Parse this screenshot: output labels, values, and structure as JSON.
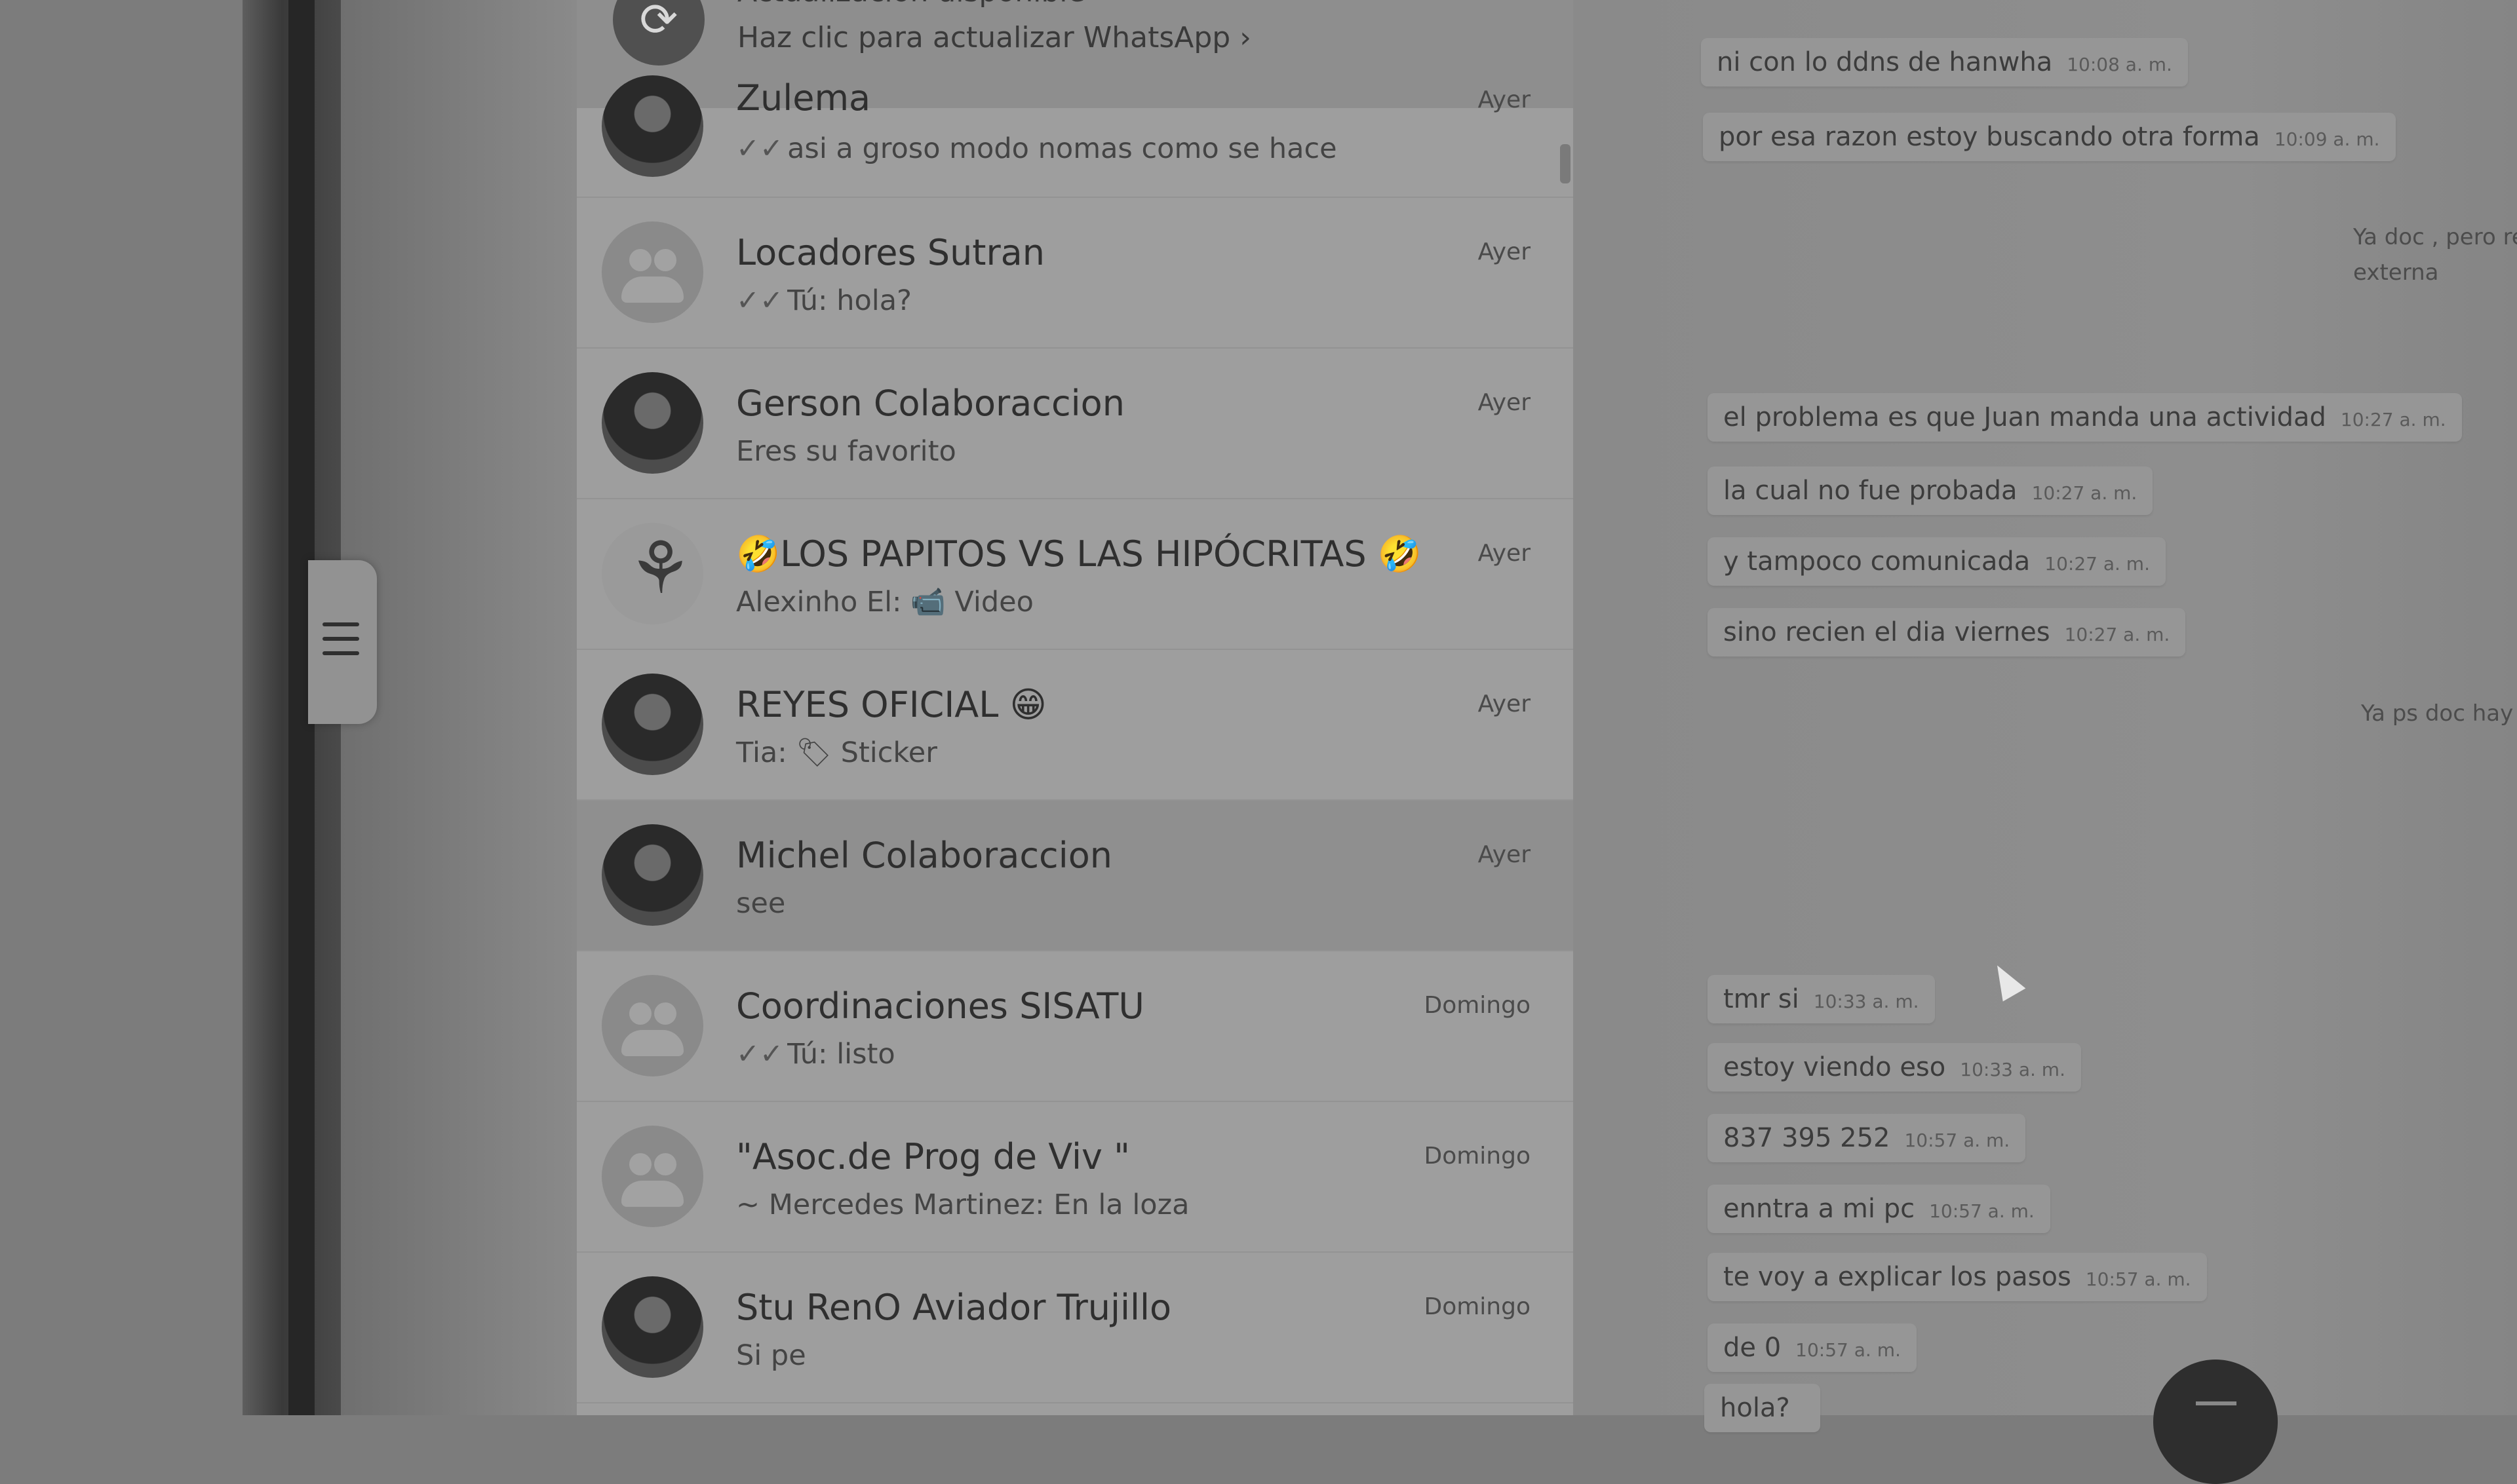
{
  "update_banner": {
    "title": "Actualización disponible",
    "subtitle": "Haz clic para actualizar WhatsApp ›",
    "icon": "refresh-icon"
  },
  "chats": [
    {
      "name": "Zulema",
      "message": "asi a groso modo nomas como se hace",
      "time": "Ayer",
      "ticks": "✓✓",
      "avatar": "photo"
    },
    {
      "name": "Locadores Sutran",
      "message": "Tú: hola?",
      "time": "Ayer",
      "ticks": "✓✓",
      "avatar": "group"
    },
    {
      "name": "Gerson Colaboraccion",
      "message": "Eres su favorito",
      "time": "Ayer",
      "ticks": "",
      "avatar": "photo"
    },
    {
      "name": "🤣LOS PAPITOS VS LAS HIPÓCRITAS 🤣",
      "message": "Alexinho El: 📹 Video",
      "time": "Ayer",
      "ticks": "",
      "avatar": "sketch"
    },
    {
      "name": "REYES OFICIAL 😁",
      "message": "Tia: 🏷 Sticker",
      "time": "Ayer",
      "ticks": "",
      "avatar": "photo"
    },
    {
      "name": "Michel Colaboraccion",
      "message": "see",
      "time": "Ayer",
      "ticks": "",
      "avatar": "photo",
      "selected": true
    },
    {
      "name": "Coordinaciones SISATU",
      "message": "Tú: listo",
      "time": "Domingo",
      "ticks": "✓✓",
      "avatar": "group"
    },
    {
      "name": "\"Asoc.de Prog de Viv \"",
      "message": "~ Mercedes Martinez: En la loza",
      "time": "Domingo",
      "ticks": "",
      "avatar": "group"
    },
    {
      "name": "Stu RenO Aviador Trujillo",
      "message": "Si pe",
      "time": "Domingo",
      "ticks": "",
      "avatar": "photo"
    }
  ],
  "conversation": {
    "incoming": [
      {
        "text": "ni con lo ddns de hanwha",
        "time": "10:08 a. m."
      },
      {
        "text": "por esa razon estoy buscando otra forma",
        "time": "10:09 a. m."
      },
      {
        "text": "el problema es que Juan manda una actividad",
        "time": "10:27 a. m."
      },
      {
        "text": "la cual no fue probada",
        "time": "10:27 a. m."
      },
      {
        "text": "y tampoco comunicada",
        "time": "10:27 a. m."
      },
      {
        "text": "sino recien el dia viernes",
        "time": "10:27 a. m."
      },
      {
        "text": "tmr si",
        "time": "10:33 a. m."
      },
      {
        "text": "estoy viendo eso",
        "time": "10:33 a. m."
      },
      {
        "text": "837 395 252",
        "time": "10:57 a. m."
      },
      {
        "text": "enntra a mi pc",
        "time": "10:57 a. m."
      },
      {
        "text": "te voy a explicar los pasos",
        "time": "10:57 a. m."
      },
      {
        "text": "de 0",
        "time": "10:57 a. m."
      },
      {
        "text": "hola?",
        "time": ""
      }
    ],
    "outgoing_partial": [
      {
        "line1": "Ya doc , pero re",
        "line2": "externa"
      },
      {
        "line1": "Ya ps doc hay q",
        "line2": ""
      }
    ]
  }
}
